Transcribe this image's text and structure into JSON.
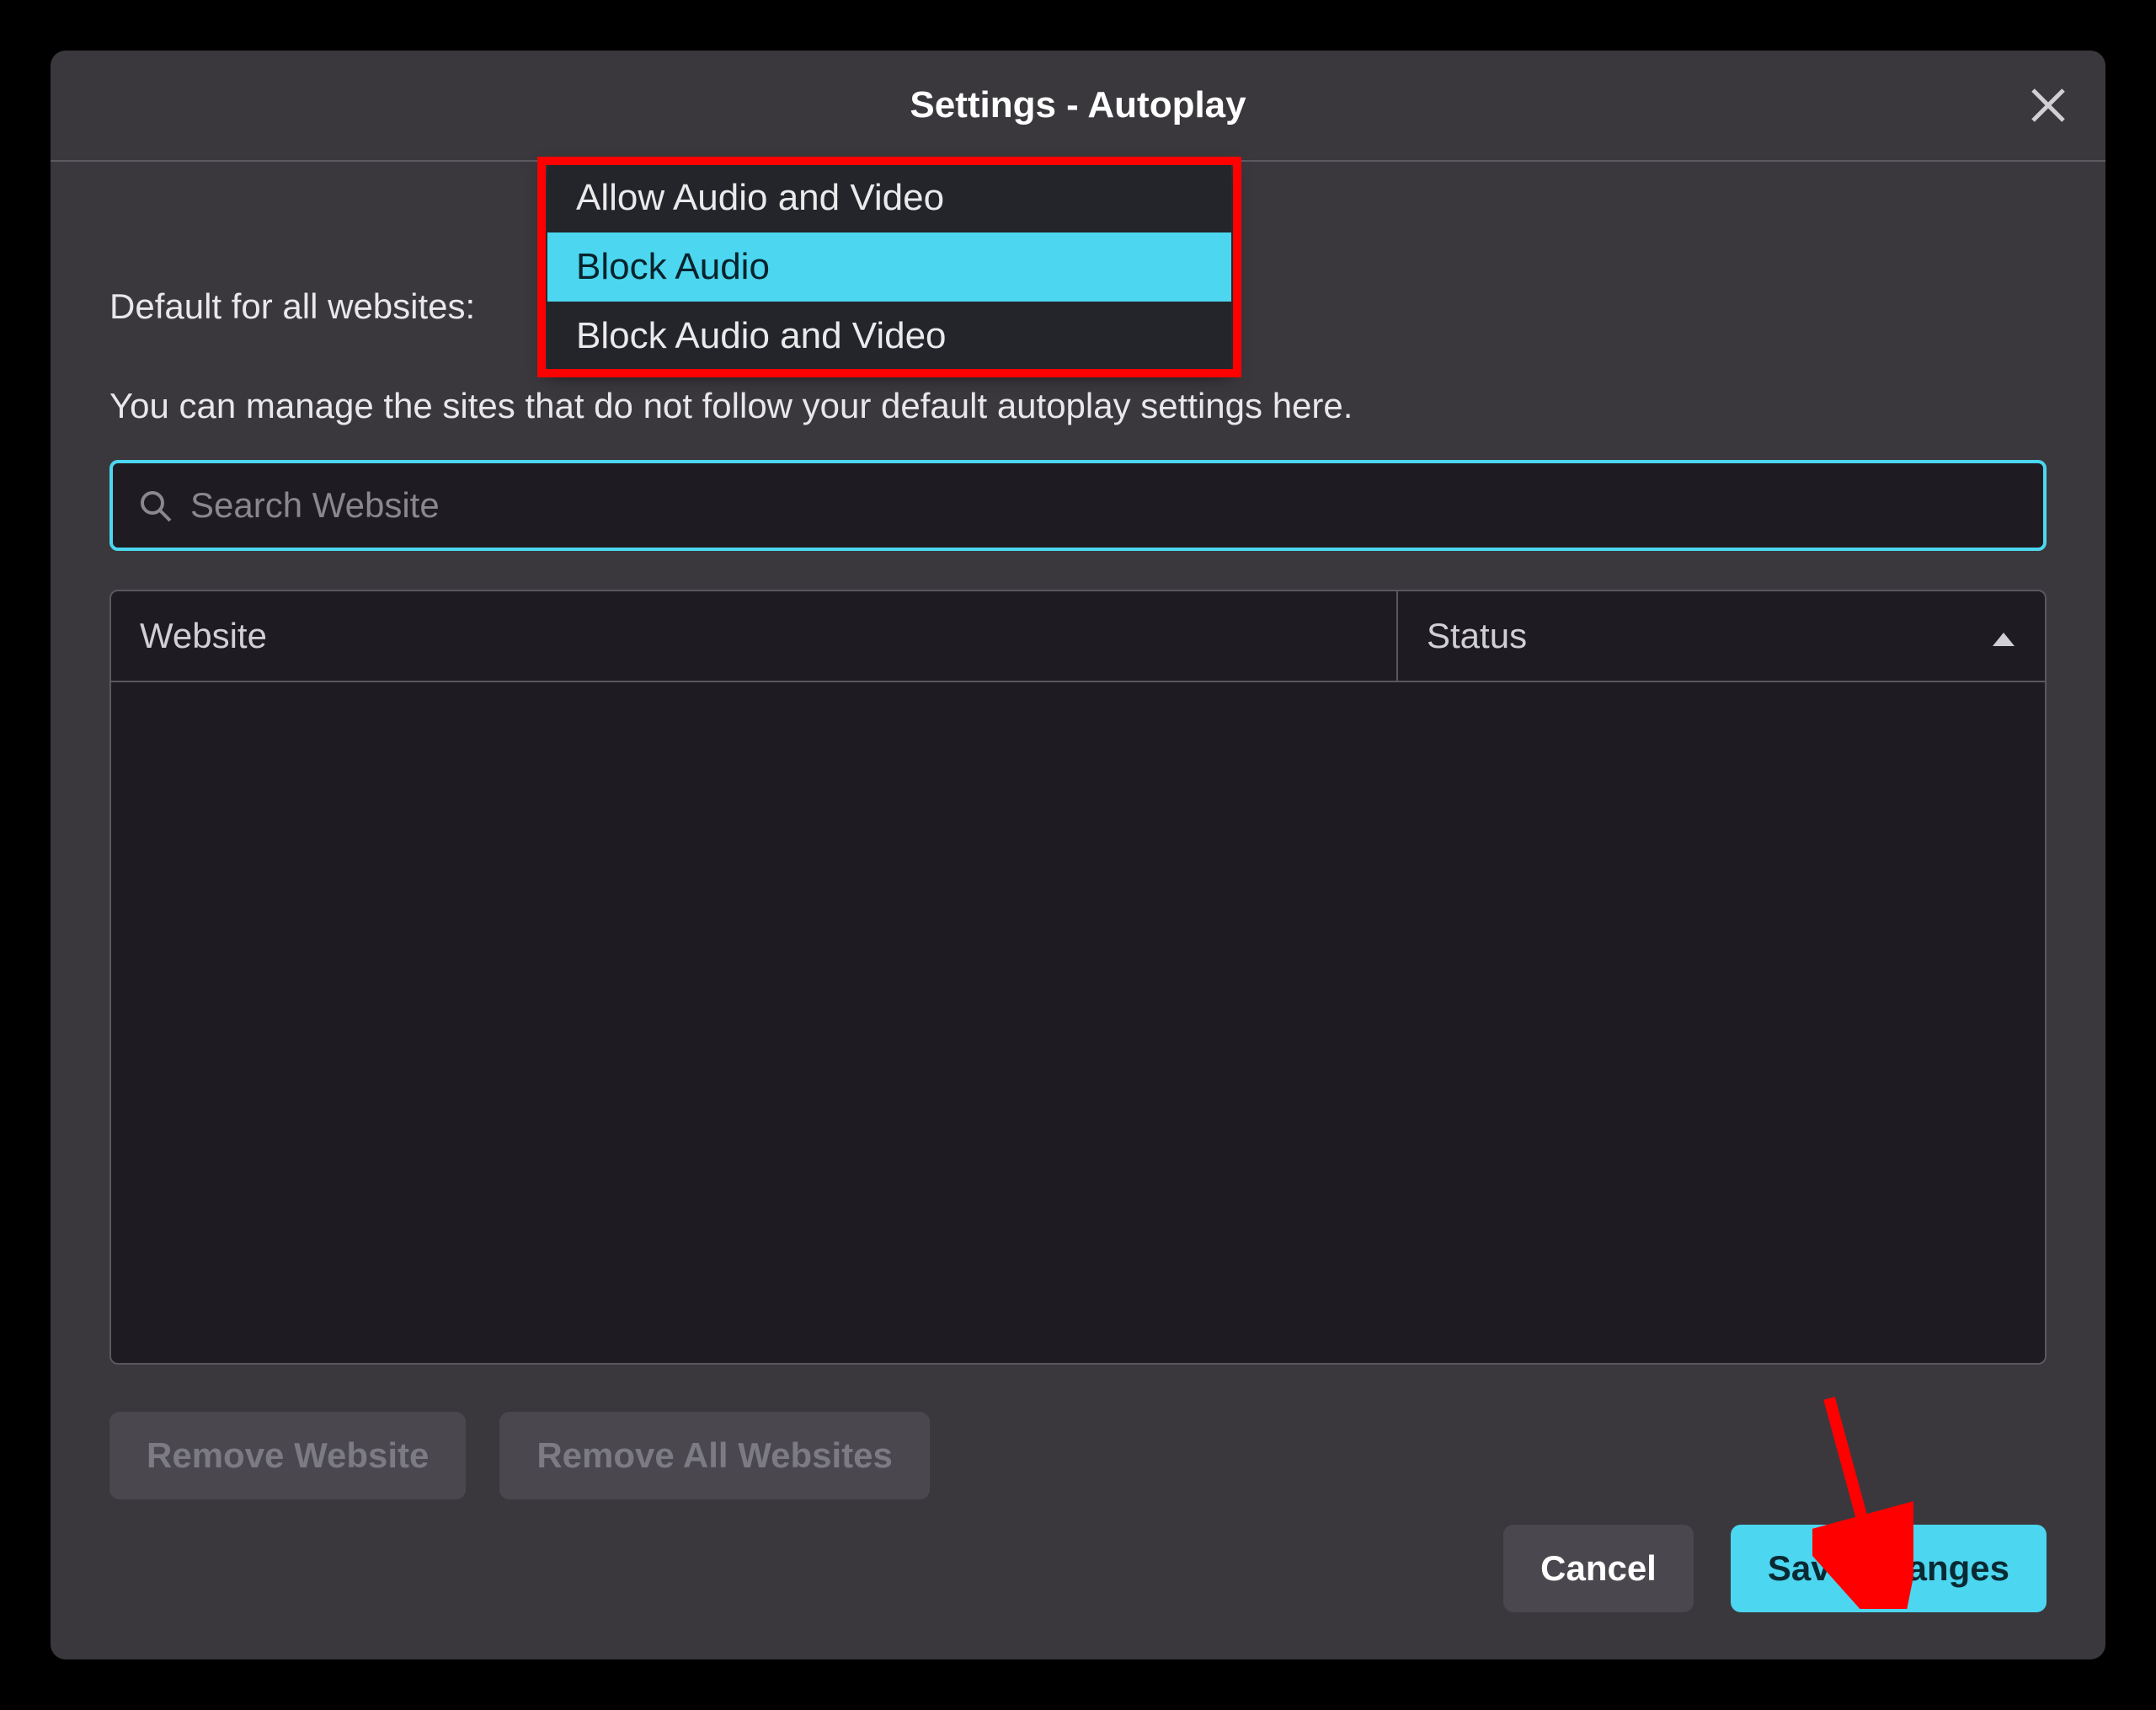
{
  "dialog": {
    "title": "Settings - Autoplay",
    "default_label": "Default for all websites:",
    "description": "You can manage the sites that do not follow your default autoplay settings here.",
    "search_placeholder": "Search Website",
    "table": {
      "col_website": "Website",
      "col_status": "Status",
      "rows": []
    },
    "buttons": {
      "remove": "Remove Website",
      "remove_all": "Remove All Websites",
      "cancel": "Cancel",
      "save": "Save Changes"
    }
  },
  "dropdown": {
    "options": [
      {
        "label": "Allow Audio and Video",
        "selected": false
      },
      {
        "label": "Block Audio",
        "selected": true
      },
      {
        "label": "Block Audio and Video",
        "selected": false
      }
    ]
  },
  "colors": {
    "accent": "#4cd6f0",
    "annotation": "#ff0000"
  }
}
